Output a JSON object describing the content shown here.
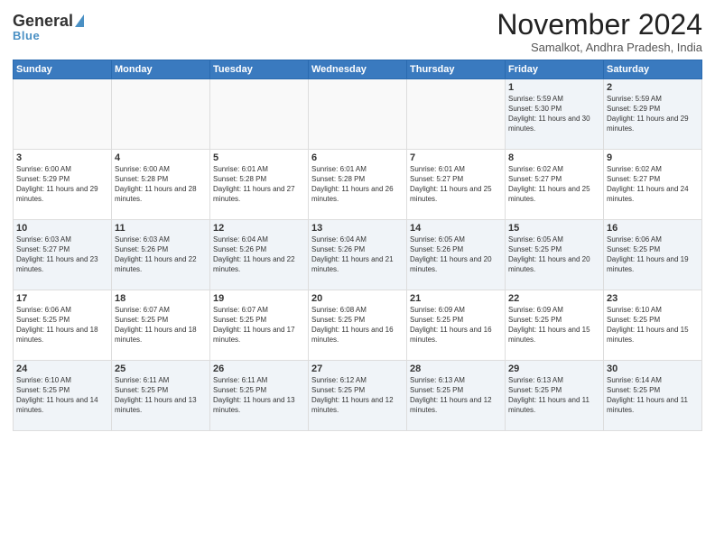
{
  "logo": {
    "general": "General",
    "blue": "Blue"
  },
  "header": {
    "month": "November 2024",
    "location": "Samalkot, Andhra Pradesh, India"
  },
  "days": [
    "Sunday",
    "Monday",
    "Tuesday",
    "Wednesday",
    "Thursday",
    "Friday",
    "Saturday"
  ],
  "weeks": [
    [
      {
        "day": "",
        "content": ""
      },
      {
        "day": "",
        "content": ""
      },
      {
        "day": "",
        "content": ""
      },
      {
        "day": "",
        "content": ""
      },
      {
        "day": "",
        "content": ""
      },
      {
        "day": "1",
        "content": "Sunrise: 5:59 AM\nSunset: 5:30 PM\nDaylight: 11 hours and 30 minutes."
      },
      {
        "day": "2",
        "content": "Sunrise: 5:59 AM\nSunset: 5:29 PM\nDaylight: 11 hours and 29 minutes."
      }
    ],
    [
      {
        "day": "3",
        "content": "Sunrise: 6:00 AM\nSunset: 5:29 PM\nDaylight: 11 hours and 29 minutes."
      },
      {
        "day": "4",
        "content": "Sunrise: 6:00 AM\nSunset: 5:28 PM\nDaylight: 11 hours and 28 minutes."
      },
      {
        "day": "5",
        "content": "Sunrise: 6:01 AM\nSunset: 5:28 PM\nDaylight: 11 hours and 27 minutes."
      },
      {
        "day": "6",
        "content": "Sunrise: 6:01 AM\nSunset: 5:28 PM\nDaylight: 11 hours and 26 minutes."
      },
      {
        "day": "7",
        "content": "Sunrise: 6:01 AM\nSunset: 5:27 PM\nDaylight: 11 hours and 25 minutes."
      },
      {
        "day": "8",
        "content": "Sunrise: 6:02 AM\nSunset: 5:27 PM\nDaylight: 11 hours and 25 minutes."
      },
      {
        "day": "9",
        "content": "Sunrise: 6:02 AM\nSunset: 5:27 PM\nDaylight: 11 hours and 24 minutes."
      }
    ],
    [
      {
        "day": "10",
        "content": "Sunrise: 6:03 AM\nSunset: 5:27 PM\nDaylight: 11 hours and 23 minutes."
      },
      {
        "day": "11",
        "content": "Sunrise: 6:03 AM\nSunset: 5:26 PM\nDaylight: 11 hours and 22 minutes."
      },
      {
        "day": "12",
        "content": "Sunrise: 6:04 AM\nSunset: 5:26 PM\nDaylight: 11 hours and 22 minutes."
      },
      {
        "day": "13",
        "content": "Sunrise: 6:04 AM\nSunset: 5:26 PM\nDaylight: 11 hours and 21 minutes."
      },
      {
        "day": "14",
        "content": "Sunrise: 6:05 AM\nSunset: 5:26 PM\nDaylight: 11 hours and 20 minutes."
      },
      {
        "day": "15",
        "content": "Sunrise: 6:05 AM\nSunset: 5:25 PM\nDaylight: 11 hours and 20 minutes."
      },
      {
        "day": "16",
        "content": "Sunrise: 6:06 AM\nSunset: 5:25 PM\nDaylight: 11 hours and 19 minutes."
      }
    ],
    [
      {
        "day": "17",
        "content": "Sunrise: 6:06 AM\nSunset: 5:25 PM\nDaylight: 11 hours and 18 minutes."
      },
      {
        "day": "18",
        "content": "Sunrise: 6:07 AM\nSunset: 5:25 PM\nDaylight: 11 hours and 18 minutes."
      },
      {
        "day": "19",
        "content": "Sunrise: 6:07 AM\nSunset: 5:25 PM\nDaylight: 11 hours and 17 minutes."
      },
      {
        "day": "20",
        "content": "Sunrise: 6:08 AM\nSunset: 5:25 PM\nDaylight: 11 hours and 16 minutes."
      },
      {
        "day": "21",
        "content": "Sunrise: 6:09 AM\nSunset: 5:25 PM\nDaylight: 11 hours and 16 minutes."
      },
      {
        "day": "22",
        "content": "Sunrise: 6:09 AM\nSunset: 5:25 PM\nDaylight: 11 hours and 15 minutes."
      },
      {
        "day": "23",
        "content": "Sunrise: 6:10 AM\nSunset: 5:25 PM\nDaylight: 11 hours and 15 minutes."
      }
    ],
    [
      {
        "day": "24",
        "content": "Sunrise: 6:10 AM\nSunset: 5:25 PM\nDaylight: 11 hours and 14 minutes."
      },
      {
        "day": "25",
        "content": "Sunrise: 6:11 AM\nSunset: 5:25 PM\nDaylight: 11 hours and 13 minutes."
      },
      {
        "day": "26",
        "content": "Sunrise: 6:11 AM\nSunset: 5:25 PM\nDaylight: 11 hours and 13 minutes."
      },
      {
        "day": "27",
        "content": "Sunrise: 6:12 AM\nSunset: 5:25 PM\nDaylight: 11 hours and 12 minutes."
      },
      {
        "day": "28",
        "content": "Sunrise: 6:13 AM\nSunset: 5:25 PM\nDaylight: 11 hours and 12 minutes."
      },
      {
        "day": "29",
        "content": "Sunrise: 6:13 AM\nSunset: 5:25 PM\nDaylight: 11 hours and 11 minutes."
      },
      {
        "day": "30",
        "content": "Sunrise: 6:14 AM\nSunset: 5:25 PM\nDaylight: 11 hours and 11 minutes."
      }
    ]
  ]
}
